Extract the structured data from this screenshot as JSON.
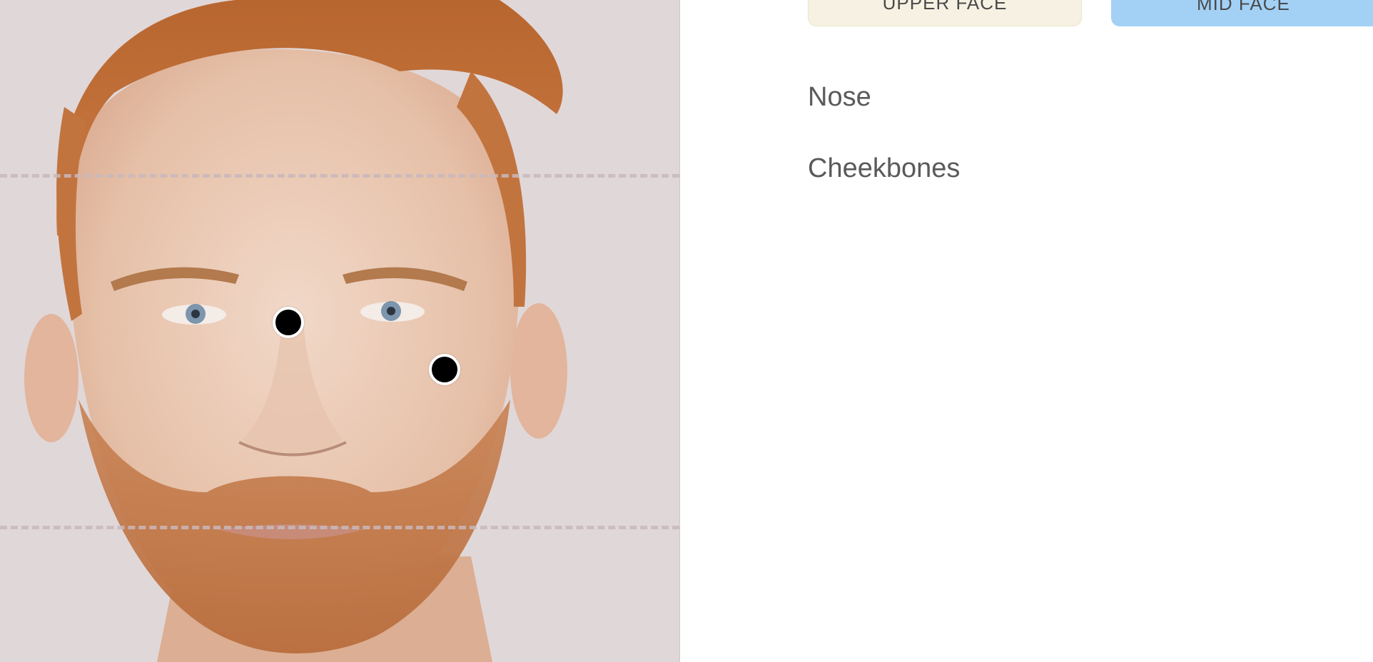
{
  "photo": {
    "subject": "front-facing portrait of a red-haired bearded man",
    "background_color": "#e0d7d8"
  },
  "zones": {
    "upper_face_label": "UPPER FACE",
    "mid_face_label": "MID FACE",
    "upper_face_color": "#f6f1e2",
    "mid_face_color": "#a3d1f6",
    "selected": "MID FACE"
  },
  "areas": {
    "items": [
      {
        "label": "Nose"
      },
      {
        "label": "Cheekbones"
      }
    ]
  },
  "colors": {
    "marker_fill": "#000000",
    "marker_ring": "#ffffff",
    "text": "#5a5a5a"
  }
}
